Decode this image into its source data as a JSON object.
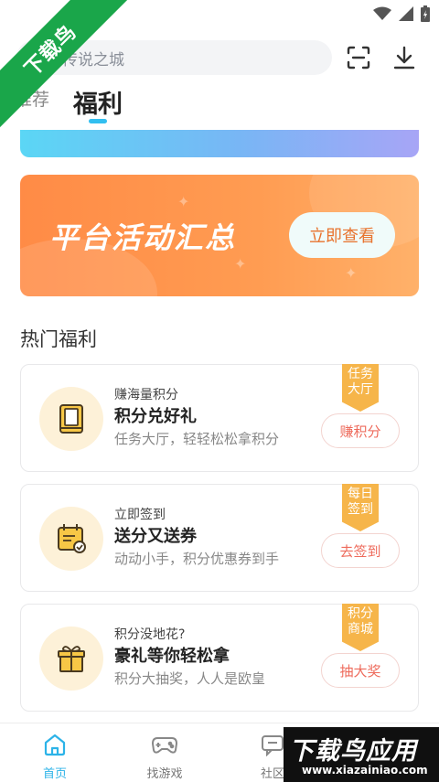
{
  "watermark": {
    "ribbon_text": "下载鸟",
    "corner_brand_text": "下载鸟应用",
    "corner_url": "www.xiazainiao.com"
  },
  "search": {
    "placeholder": "传说之城"
  },
  "tabs": [
    {
      "label": "推荐",
      "active": false
    },
    {
      "label": "福利",
      "active": true
    }
  ],
  "banner": {
    "title": "平台活动汇总",
    "button_label": "立即查看"
  },
  "section": {
    "title": "热门福利"
  },
  "cards": [
    {
      "subtitle": "赚海量积分",
      "title": "积分兑好礼",
      "description": "任务大厅，轻轻松松拿积分",
      "flag": "任务大厅",
      "action": "赚积分",
      "icon": "book-icon"
    },
    {
      "subtitle": "立即签到",
      "title": "送分又送券",
      "description": "动动小手，积分优惠券到手",
      "flag": "每日签到",
      "action": "去签到",
      "icon": "calendar-check-icon"
    },
    {
      "subtitle": "积分没地花?",
      "title": "豪礼等你轻松拿",
      "description": "积分大抽奖，人人是欧皇",
      "flag": "积分商城",
      "action": "抽大奖",
      "icon": "gift-icon"
    }
  ],
  "bottom_nav": [
    {
      "label": "首页",
      "active": true
    },
    {
      "label": "找游戏",
      "active": false
    },
    {
      "label": "社区",
      "active": false
    }
  ],
  "colors": {
    "accent": "#2cb3e8",
    "banner_orange": "#ff9245",
    "flag_yellow": "#f6b54a",
    "action_red": "#ee6b5c"
  }
}
